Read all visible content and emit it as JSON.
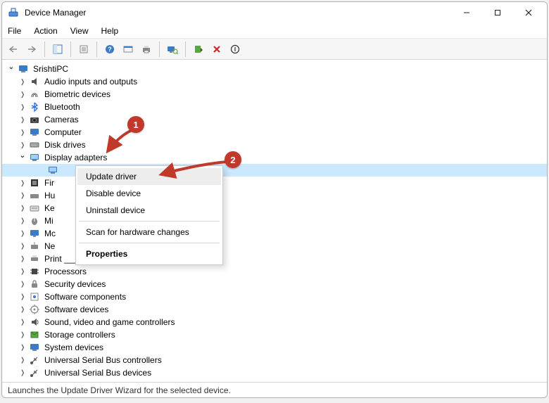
{
  "title": "Device Manager",
  "menubar": {
    "file": "File",
    "action": "Action",
    "view": "View",
    "help": "Help"
  },
  "root": "SrishtiPC",
  "devices": {
    "audio": "Audio inputs and outputs",
    "biometric": "Biometric devices",
    "bluetooth": "Bluetooth",
    "cameras": "Cameras",
    "computer": "Computer",
    "diskdrives": "Disk drives",
    "display": "Display adapters",
    "firmware": "Fir",
    "hid": "Hu",
    "keyboards": "Ke",
    "mice": "Mi",
    "monitors": "Mc",
    "network": "Ne",
    "printqueues": "Print ______",
    "processors": "Processors",
    "security": "Security devices",
    "softcomp": "Software components",
    "softdev": "Software devices",
    "sound": "Sound, video and game controllers",
    "storage": "Storage controllers",
    "sysdev": "System devices",
    "usbcont": "Universal Serial Bus controllers",
    "usbdev": "Universal Serial Bus devices"
  },
  "context": {
    "update": "Update driver",
    "disable": "Disable device",
    "uninstall": "Uninstall device",
    "scan": "Scan for hardware changes",
    "properties": "Properties"
  },
  "callouts": {
    "one": "1",
    "two": "2"
  },
  "statusbar": "Launches the Update Driver Wizard for the selected device."
}
